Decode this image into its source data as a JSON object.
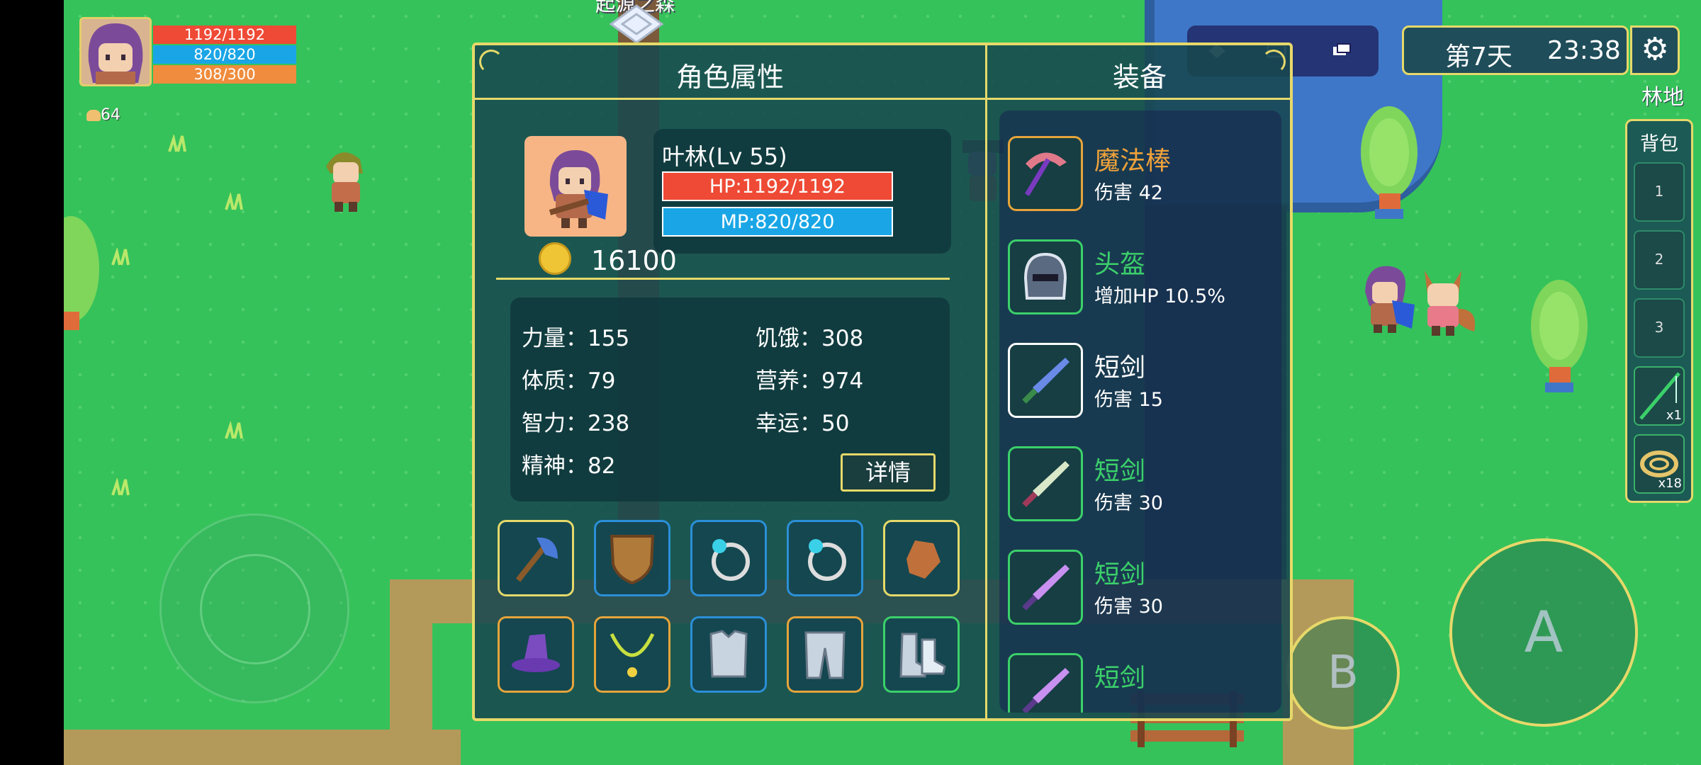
{
  "area_label": "起源之森",
  "player": {
    "hp": "1192/1192",
    "mp": "820/820",
    "sp": "308/300",
    "food_count": "64"
  },
  "clock": {
    "day": "第7天",
    "time": "23:38"
  },
  "location": "林地",
  "backpack": {
    "title": "背包",
    "slots": [
      {
        "label": "1",
        "count": ""
      },
      {
        "label": "2",
        "count": ""
      },
      {
        "label": "3",
        "count": ""
      },
      {
        "label": "",
        "count": "x1",
        "icon": "fishing-rod-icon"
      },
      {
        "label": "",
        "count": "x18",
        "icon": "rope-icon"
      }
    ]
  },
  "controls": {
    "a_label": "A",
    "b_label": "B"
  },
  "dialog": {
    "title_left": "角色属性",
    "title_right": "装备",
    "character": {
      "name": "叶林(Lv 55)",
      "hp": "HP:1192/1192",
      "mp": "MP:820/820",
      "gold": "16100"
    },
    "stats": {
      "strength": "力量：155",
      "constitution": "体质：79",
      "intelligence": "智力：238",
      "spirit": "精神：82",
      "hunger": "饥饿：308",
      "nutrition": "营养：974",
      "luck": "幸运：50"
    },
    "detail_button": "详情",
    "equip_slots": [
      {
        "icon": "axe-icon",
        "border": "#e6d96a"
      },
      {
        "icon": "shield-icon",
        "border": "#2b8fd8"
      },
      {
        "icon": "ring-icon",
        "border": "#2b8fd8"
      },
      {
        "icon": "ring-icon",
        "border": "#2b8fd8"
      },
      {
        "icon": "glove-icon",
        "border": "#e6d96a"
      },
      {
        "icon": "wizard-hat-icon",
        "border": "#e6a43a"
      },
      {
        "icon": "necklace-icon",
        "border": "#e6a43a"
      },
      {
        "icon": "armor-icon",
        "border": "#2b8fd8"
      },
      {
        "icon": "leggings-icon",
        "border": "#e6a43a"
      },
      {
        "icon": "boots-icon",
        "border": "#3bd06a"
      }
    ],
    "equipment": [
      {
        "name": "魔法棒",
        "desc": "伤害 42",
        "color": "#f0a23a",
        "icon": "pickaxe-icon"
      },
      {
        "name": "头盔",
        "desc": "增加HP 10.5%",
        "color": "#3bd06a",
        "icon": "helmet-icon"
      },
      {
        "name": "短剑",
        "desc": "伤害 15",
        "color": "#ffffff",
        "icon": "sword-icon"
      },
      {
        "name": "短剑",
        "desc": "伤害 30",
        "color": "#3bd06a",
        "icon": "sword-icon"
      },
      {
        "name": "短剑",
        "desc": "伤害 30",
        "color": "#3bd06a",
        "icon": "sword-icon"
      },
      {
        "name": "短剑",
        "desc": "",
        "color": "#3bd06a",
        "icon": "sword-icon"
      }
    ]
  }
}
